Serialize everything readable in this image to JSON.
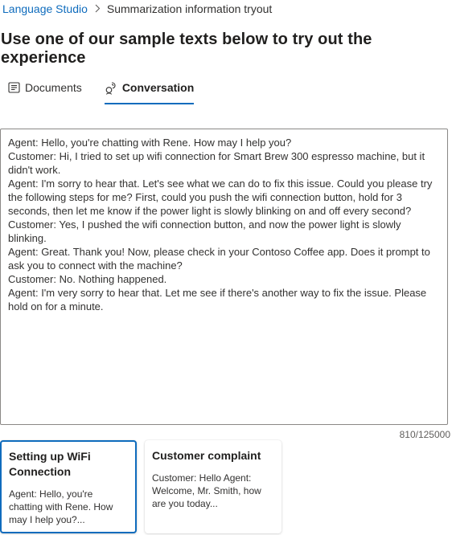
{
  "breadcrumb": {
    "root": "Language Studio",
    "current": "Summarization information tryout"
  },
  "page_title": "Use one of our sample texts below to try out the experience",
  "tabs": [
    {
      "label": "Documents",
      "icon": "document-icon",
      "selected": false
    },
    {
      "label": "Conversation",
      "icon": "conversation-icon",
      "selected": true
    }
  ],
  "editor": {
    "text": "Agent: Hello, you're chatting with Rene. How may I help you?\nCustomer: Hi, I tried to set up wifi connection for Smart Brew 300 espresso machine, but it didn't work.\nAgent: I'm sorry to hear that. Let's see what we can do to fix this issue. Could you please try the following steps for me? First, could you push the wifi connection button, hold for 3 seconds, then let me know if the power light is slowly blinking on and off every second?\nCustomer: Yes, I pushed the wifi connection button, and now the power light is slowly blinking.\nAgent: Great. Thank you! Now, please check in your Contoso Coffee app. Does it prompt to ask you to connect with the machine?\nCustomer: No. Nothing happened.\nAgent: I'm very sorry to hear that. Let me see if there's another way to fix the issue. Please hold on for a minute.",
    "char_count": "810/125000"
  },
  "samples": [
    {
      "title": "Setting up WiFi Connection",
      "desc": "Agent: Hello, you're chatting with Rene. How may I help you?...",
      "selected": true
    },
    {
      "title": "Customer complaint",
      "desc": "Customer: Hello Agent: Welcome, Mr. Smith, how are you today...",
      "selected": false
    }
  ],
  "colors": {
    "accent": "#0f6cbd",
    "text": "#323130",
    "border": "#8a8886"
  }
}
